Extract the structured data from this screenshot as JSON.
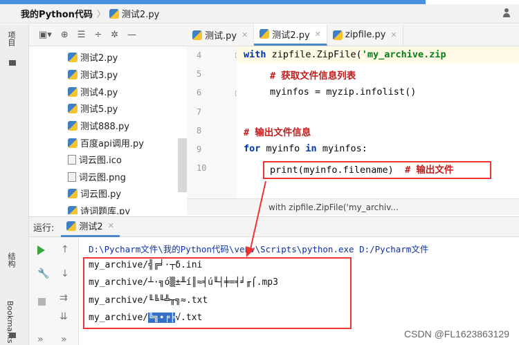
{
  "breadcrumb": {
    "root": "我的Python代码",
    "file": "测试2.py"
  },
  "project_toolbar": {
    "icons": [
      "layout-icon",
      "target-icon",
      "collapse-icon",
      "expand-icon",
      "gear-icon",
      "minimize-icon"
    ]
  },
  "side_tabs": {
    "project": "项目",
    "structure": "结构",
    "bookmarks": "Bookmarks"
  },
  "tree_items": [
    {
      "label": "测试2.py",
      "icon": "python-file-icon"
    },
    {
      "label": "测试3.py",
      "icon": "python-file-icon"
    },
    {
      "label": "测试4.py",
      "icon": "python-file-icon"
    },
    {
      "label": "测试5.py",
      "icon": "python-file-icon"
    },
    {
      "label": "测试888.py",
      "icon": "python-file-icon"
    },
    {
      "label": "百度api调用.py",
      "icon": "python-file-icon"
    },
    {
      "label": "词云图.ico",
      "icon": "text-file-icon"
    },
    {
      "label": "词云图.png",
      "icon": "text-file-icon"
    },
    {
      "label": "词云图.py",
      "icon": "python-file-icon"
    },
    {
      "label": "诗词题库.py",
      "icon": "python-file-icon"
    }
  ],
  "editor_tabs": [
    {
      "label": "测试.py",
      "active": false
    },
    {
      "label": "测试2.py",
      "active": true
    },
    {
      "label": "zipfile.py",
      "active": false
    }
  ],
  "code": {
    "line_numbers": [
      "4",
      "5",
      "6",
      "7",
      "8",
      "9",
      "10"
    ],
    "line4": {
      "kw": "with",
      "a": " zipfile.",
      "b": "ZipFile",
      "c": "(",
      "str": "'my_archive.zip"
    },
    "line5": {
      "comment": "# 获取文件信息列表"
    },
    "line6": {
      "text": "myinfos = myzip.infolist()"
    },
    "line8": {
      "comment": "# 输出文件信息"
    },
    "line9": {
      "kw1": "for",
      "mid": " myinfo ",
      "kw2": "in",
      "end": " myinfos:"
    },
    "line10": {
      "text": "print(myinfo.filename)",
      "comment": "# 输出文件"
    }
  },
  "hint": "with zipfile.ZipFile('my_archiv...",
  "run": {
    "label": "运行:",
    "tab": "测试2"
  },
  "console": {
    "command": "D:\\Pycharm文件\\我的Python代码\\venv\\Scripts\\python.exe D:/Pycharm文件",
    "outputs": [
      {
        "prefix": "my_archive/",
        "body": "╣╔╛·┬δ.ini",
        "selected": ""
      },
      {
        "prefix": "my_archive/",
        "body": "┴·╗ó▒±╨í║≈╡ú╙┤╪=╡╛╓⌠.mp3",
        "selected": ""
      },
      {
        "prefix": "my_archive/",
        "body": "╙╚╙╩╥╗≈.txt",
        "selected": ""
      },
      {
        "prefix": "my_archive/",
        "body": "",
        "selected": "╚╗∙╒╞",
        "tail": "√.txt"
      }
    ]
  },
  "colors": {
    "accent": "#4a88c7",
    "annotation": "#e33333",
    "keyword": "#0033b3",
    "string": "#067d17"
  },
  "watermark": "CSDN @FL1623863129"
}
